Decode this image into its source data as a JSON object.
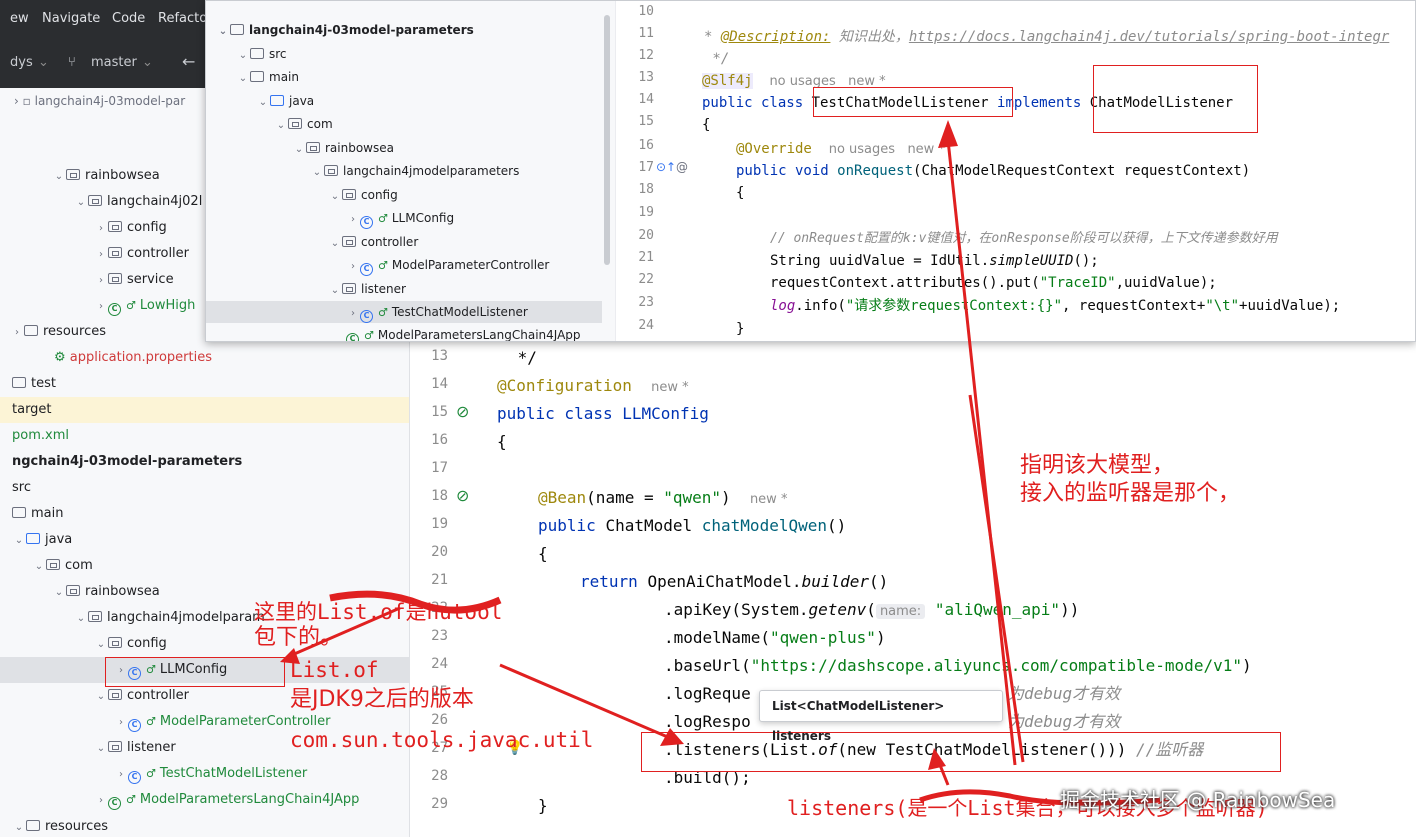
{
  "menu": [
    "ew",
    "Navigate",
    "Code",
    "Refacto"
  ],
  "toolbar": {
    "project": "dys",
    "branch": "master"
  },
  "breadcrumb": "langchain4j-03model-par",
  "left_tree": [
    {
      "label": "rainbowsea",
      "kind": "folder"
    },
    {
      "label": "langchain4j02l",
      "kind": "folder"
    },
    {
      "label": "config",
      "kind": "folder"
    },
    {
      "label": "controller",
      "kind": "folder"
    },
    {
      "label": "service",
      "kind": "folder"
    },
    {
      "label": "LowHigh",
      "kind": "app"
    },
    {
      "label": "resources",
      "kind": "folder"
    },
    {
      "label": "application.properties",
      "kind": "props"
    },
    {
      "label": "test",
      "kind": "folder"
    },
    {
      "label": "target",
      "kind": "folder"
    },
    {
      "label": "pom.xml",
      "kind": "pom"
    },
    {
      "label": "ngchain4j-03model-parameters",
      "kind": "module"
    },
    {
      "label": "src",
      "kind": "folder"
    },
    {
      "label": "main",
      "kind": "folder"
    },
    {
      "label": "java",
      "kind": "folder"
    },
    {
      "label": "com",
      "kind": "folder"
    },
    {
      "label": "rainbowsea",
      "kind": "folder"
    },
    {
      "label": "langchain4jmodelparam",
      "kind": "folder"
    },
    {
      "label": "config",
      "kind": "folder"
    },
    {
      "label": "LLMConfig",
      "kind": "class"
    },
    {
      "label": "controller",
      "kind": "folder"
    },
    {
      "label": "ModelParameterController",
      "kind": "class"
    },
    {
      "label": "listener",
      "kind": "folder"
    },
    {
      "label": "TestChatModelListener",
      "kind": "class"
    },
    {
      "label": "ModelParametersLangChain4JApp",
      "kind": "app"
    },
    {
      "label": "resources",
      "kind": "folder"
    }
  ],
  "popup_tree": [
    {
      "label": "langchain4j-03model-parameters"
    },
    {
      "label": "src"
    },
    {
      "label": "main"
    },
    {
      "label": "java"
    },
    {
      "label": "com"
    },
    {
      "label": "rainbowsea"
    },
    {
      "label": "langchain4jmodelparameters"
    },
    {
      "label": "config"
    },
    {
      "label": "LLMConfig"
    },
    {
      "label": "controller"
    },
    {
      "label": "ModelParameterController"
    },
    {
      "label": "listener"
    },
    {
      "label": "TestChatModelListener"
    },
    {
      "label": "ModelParametersLangChain4JApp"
    }
  ],
  "popup_code": {
    "line_numbers": [
      "10",
      "11",
      "12",
      "13",
      "14",
      "15",
      "16",
      "17",
      "18",
      "19",
      "20",
      "21",
      "22",
      "23",
      "24"
    ],
    "l11_tag": "@Description:",
    "l11_text": " 知识出处，",
    "l11_url": "https://docs.langchain4j.dev/tutorials/spring-boot-integr",
    "l12": " */",
    "l13_ann": "@Slf4j",
    "l13_hint": "no usages   new *",
    "l14_kw": "public class ",
    "l14_name": "TestChatModelListener",
    "l14_impl": " implements ",
    "l14_iface": "ChatModelListener",
    "l15": "{",
    "l16_ann": "@Override",
    "l16_hint": "no usages   new *",
    "l17_kw": "public void ",
    "l17_fn": "onRequest",
    "l17_rest": "(ChatModelRequestContext requestContext)",
    "l18": "{",
    "l20": "// onRequest配置的k:v键值对，在onResponse阶段可以获得，上下文传递参数好用",
    "l21_a": "String uuidValue = IdUtil.",
    "l21_b": "simpleUUID",
    "l21_c": "();",
    "l22_a": "requestContext.attributes().put(",
    "l22_b": "\"TraceID\"",
    "l22_c": ",uuidValue);",
    "l23_a": "log",
    "l23_b": ".info(",
    "l23_c": "\"请求参数requestContext:{}\"",
    "l23_d": ", requestContext+",
    "l23_e": "\"\\t\"",
    "l23_f": "+uuidValue);",
    "l24": "}"
  },
  "main_code": {
    "line_numbers": [
      "13",
      "14",
      "15",
      "16",
      "17",
      "18",
      "19",
      "20",
      "21",
      "22",
      "23",
      "24",
      "25",
      "26",
      "27",
      "28",
      "29"
    ],
    "l13": " */",
    "l14_ann": "@Configuration",
    "l14_hint": "new *",
    "l15": "public class LLMConfig",
    "l16": "{",
    "l18_ann": "@Bean",
    "l18_a": "(name = ",
    "l18_str": "\"qwen\"",
    "l18_b": ")",
    "l18_hint": "new *",
    "l19_kw": "public ",
    "l19_type": "ChatModel ",
    "l19_fn": "chatModelQwen",
    "l19_rest": "()",
    "l20": "{",
    "l21_kw": "return ",
    "l21_a": "OpenAiChatModel.",
    "l21_b": "builder",
    "l21_c": "()",
    "l22_a": ".apiKey(System.",
    "l22_b": "getenv",
    "l22_c": "(",
    "l22_inlay": "name:",
    "l22_str": "\"aliQwen_api\"",
    "l22_d": "))",
    "l23_a": ".modelName(",
    "l23_str": "\"qwen-plus\"",
    "l23_b": ")",
    "l24_a": ".baseUrl(",
    "l24_str": "\"https://dashscope.aliyuncs.com/compatible-mode/v1\"",
    "l24_b": ")",
    "l25": ".logReque",
    "l25_cm": "为debug才有效",
    "l26": ".logRespo",
    "l26_cm": "为debug才有效",
    "l27_a": ".listeners(",
    "l27_b": "List.",
    "l27_c": "of",
    "l27_d": "(new TestChatModelListener())",
    "l27_e": ")",
    "l27_cm": " //监听器",
    "l28": ".build();",
    "l29": "}"
  },
  "tooltip": "List<ChatModelListener> listeners",
  "annotations": {
    "a1_l1": "指明该大模型，",
    "a1_l2": "接入的监听器是那个，",
    "a2_l1": "这里的List.of是hutool",
    "a2_l2": "包下的。",
    "a2_l3": "List.of",
    "a2_l4": "是JDK9之后的版本",
    "a2_l5": "com.sun.tools.javac.util",
    "a3": "listeners(是一个List集合，可以接入多个监听器)"
  },
  "watermark": "掘金技术社区 @ RainbowSea",
  "colors": {
    "annotation_red": "#e02020",
    "keyword": "#0033b3",
    "string": "#067d17"
  }
}
